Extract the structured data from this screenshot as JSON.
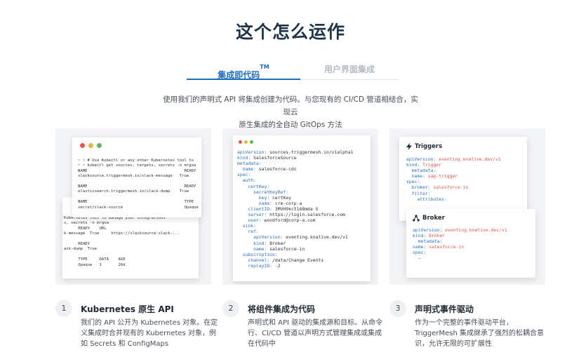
{
  "heading": "这个怎么运作",
  "tabs": {
    "active_label": "集成即代码",
    "active_sup": "TM",
    "inactive_label": "用户界面集成"
  },
  "description_lines": [
    "使用我们的声明式 API 将集成创建为代码。与您现有的 CI/CD 管道相结合，实现云",
    "原生集成的全自动 GitOps 方法"
  ],
  "panel1": {
    "front_terminal": "~ ~ # Use Kubectl or any other Kubernetes tool to\n~ ~ kubectl get sources, targets, secrets -n mrgoa\nNAME                                         READY\nslacksource.triggermesh.io/slack-message   True\n\nNAME                                         READY\nelasticsearch.triggermesh.io/slack-dump    True\n\nNAME                                         TYPE\nsecret/slack-source                          Opaque",
    "back_terminal": "Kubernetes tool to manage your integrations\ns, secrets -n mrgoa\n      READY    URL\nk-message  True     https://slacksource-slack-...\n\n      READY\nack-dump  True\n\n      TYPE     DATA    AGE\n      Opaque   1       26d"
  },
  "panel2": {
    "yaml": [
      {
        "i": 0,
        "k": "apiVersion:",
        "v": " sources.triggermesh.io/v1alpha1"
      },
      {
        "i": 0,
        "k": "kind:",
        "v": " SalesforceSource"
      },
      {
        "i": 0,
        "k": "metadata:",
        "v": ""
      },
      {
        "i": 1,
        "k": "name:",
        "v": " salesforce-cdc"
      },
      {
        "i": 0,
        "k": "spec:",
        "v": ""
      },
      {
        "i": 1,
        "k": "auth:",
        "v": ""
      },
      {
        "i": 2,
        "k": "certKey:",
        "v": ""
      },
      {
        "i": 3,
        "k": "secretKeyRef:",
        "v": ""
      },
      {
        "i": 4,
        "k": "key:",
        "v": " certKey"
      },
      {
        "i": 4,
        "k": "name:",
        "v": " crm-corp-a"
      },
      {
        "i": 2,
        "k": "clientID:",
        "v": " 3MVH9kct168mda S"
      },
      {
        "i": 2,
        "k": "server:",
        "v": " https://login.salesforce.com"
      },
      {
        "i": 2,
        "k": "user:",
        "v": " woodford@corp-a.com"
      },
      {
        "i": 1,
        "k": "sink:",
        "v": ""
      },
      {
        "i": 2,
        "k": "ref:",
        "v": ""
      },
      {
        "i": 3,
        "k": "apiVersion:",
        "v": " eventing.knative.dev/v1"
      },
      {
        "i": 3,
        "k": "kind:",
        "v": " Broker"
      },
      {
        "i": 3,
        "k": "name:",
        "v": " salesforce-in"
      },
      {
        "i": 1,
        "k": "subscription:",
        "v": ""
      },
      {
        "i": 2,
        "k": "channel:",
        "v": " /data/Change Events"
      },
      {
        "i": 2,
        "k": "replayID:",
        "v": " -2"
      }
    ]
  },
  "panel3": {
    "triggers_title": "Triggers",
    "triggers_yaml": [
      {
        "i": 0,
        "k": "apiVersion:",
        "v": " eventing.knative.dev/v1"
      },
      {
        "i": 0,
        "k": "kind:",
        "v": " Trigger"
      },
      {
        "i": 1,
        "k": "metadata:",
        "v": ""
      },
      {
        "i": 1,
        "k": "name:",
        "v": " sap-trigger"
      },
      {
        "i": 0,
        "k": "spec:",
        "v": ""
      },
      {
        "i": 1,
        "k": "broker:",
        "v": " salesforce-in"
      },
      {
        "i": 1,
        "k": "filter:",
        "v": ""
      },
      {
        "i": 2,
        "k": "attributes:",
        "v": ""
      }
    ],
    "broker_title": "Broker",
    "broker_yaml": [
      {
        "i": 0,
        "k": "apiVersion:",
        "v": " eventing.knative.dev/v1"
      },
      {
        "i": 0,
        "k": "kind:",
        "v": " Broker"
      },
      {
        "i": 1,
        "k": "metadata:",
        "v": ""
      },
      {
        "i": 0,
        "k": "name:",
        "v": " salesforce-in"
      },
      {
        "i": 0,
        "k": "spec:",
        "v": ""
      },
      {
        "i": 1,
        "k": "",
        "v": "–"
      }
    ]
  },
  "steps": [
    {
      "num": "1",
      "title": "Kubernetes 原生 API",
      "desc": "我们的 API 公开为 Kubernetes 对象。在定义集成时合并现有的 Kubernetes 对象，例如 Secrets 和 ConfigMaps"
    },
    {
      "num": "2",
      "title": "将组件集成为代码",
      "desc": "声明式和 API 驱动的集成源和目标。从命令行、CI/CD 管道以声明方式管理集成或集成在代码中"
    },
    {
      "num": "3",
      "title": "声明式事件驱动",
      "desc": "作为一个完整的事件驱动平台，TriggerMesh 集成继承了强烈的松耦合意识，允许无限的可扩展性"
    }
  ],
  "colors": {
    "accent": "#1f6fbf",
    "yaml_key": "#2a6fbe",
    "yaml_value_red": "#d9544d",
    "dot_red": "#e8564f",
    "dot_yellow": "#e9b53a",
    "dot_green": "#5fb957"
  },
  "icons": [
    "lightning-icon",
    "broker-icon"
  ]
}
